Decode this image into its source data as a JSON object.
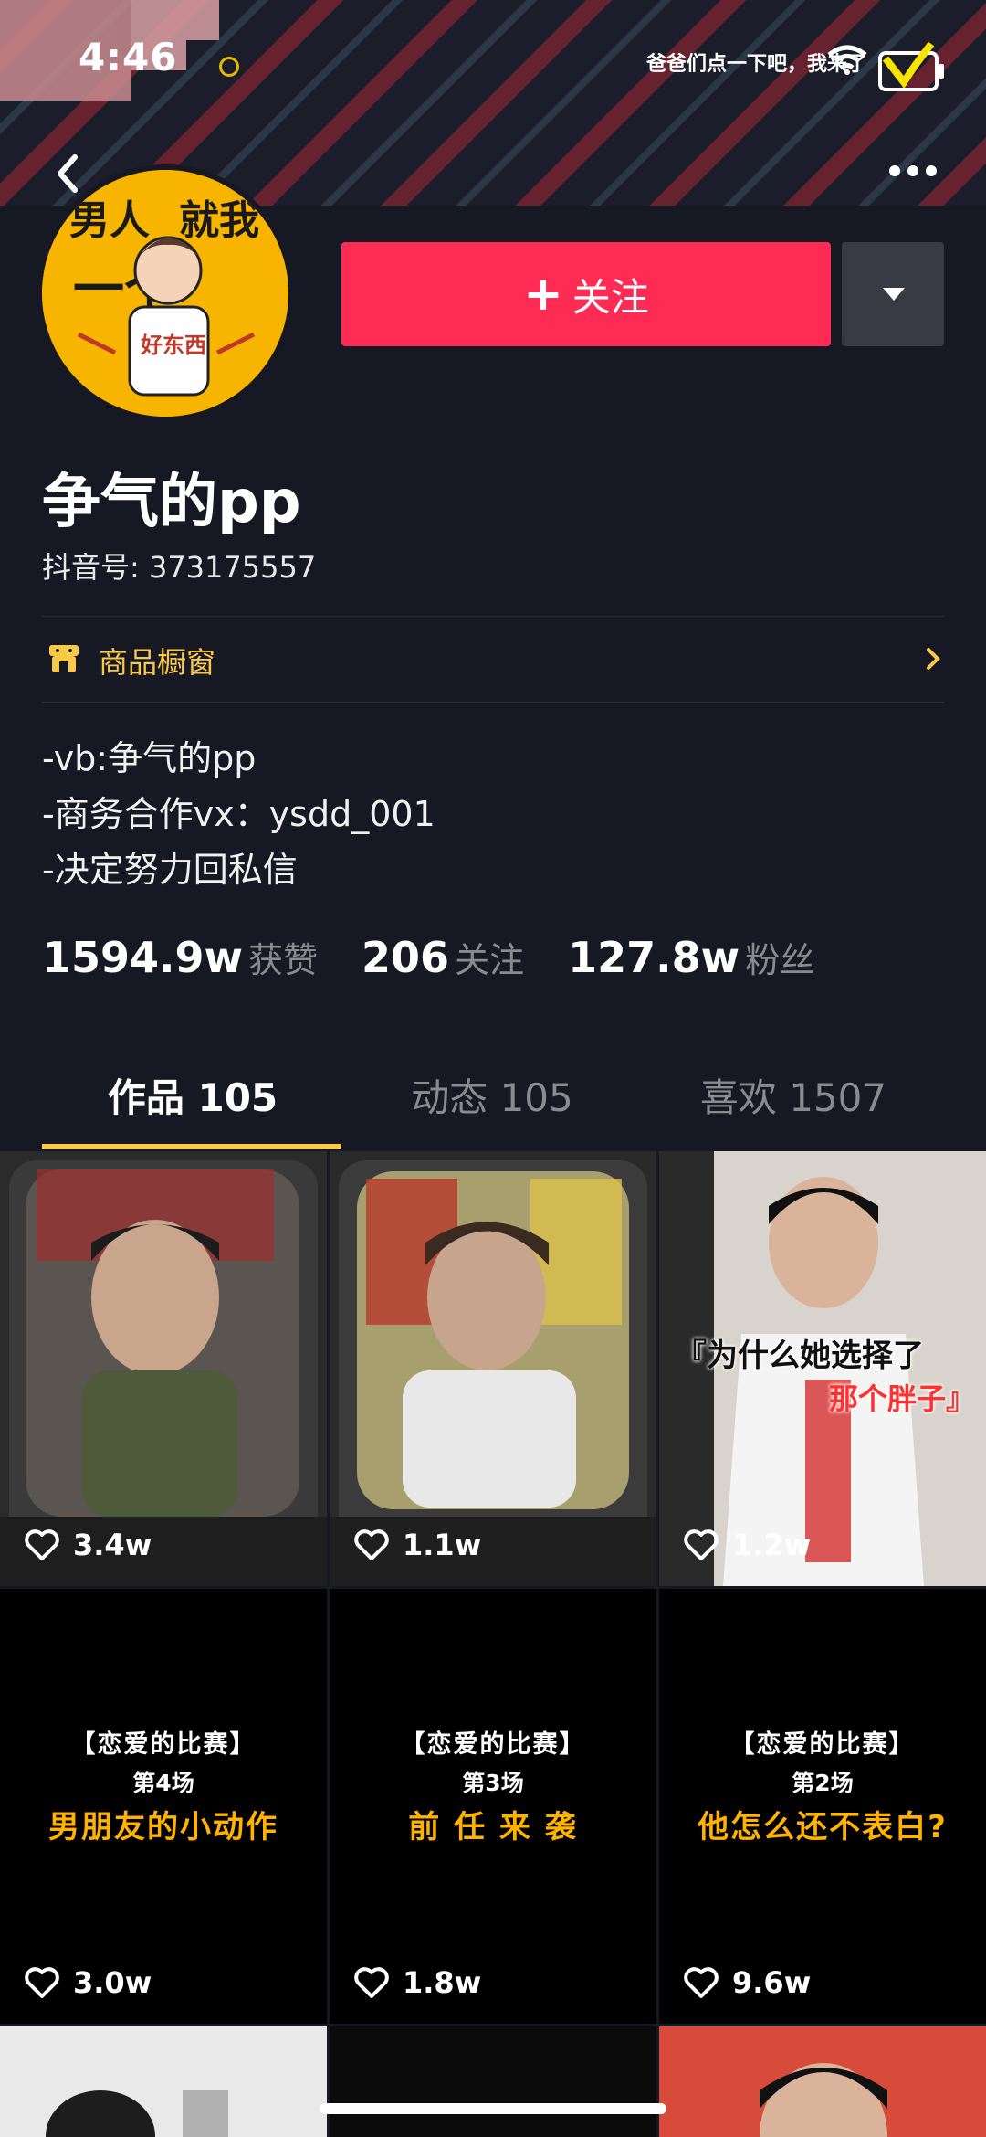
{
  "status_bar": {
    "time": "4:46",
    "ticker": "爸爸们点一下吧，我来了"
  },
  "profile": {
    "follow_label": "关注",
    "nickname": "争气的pp",
    "douyin_id": "抖音号: 373175557",
    "shop_label": "商品橱窗",
    "bio": [
      "-vb:争气的pp",
      "-商务合作vx：ysdd_001",
      "-决定努力回私信"
    ],
    "avatar_text": [
      "男人",
      "就我",
      "一个",
      "好东西"
    ]
  },
  "stats": [
    {
      "value": "1594.9w",
      "label": "获赞"
    },
    {
      "value": "206",
      "label": "关注"
    },
    {
      "value": "127.8w",
      "label": "粉丝"
    }
  ],
  "tabs": [
    {
      "label": "作品 105",
      "active": true
    },
    {
      "label": "动态 105",
      "active": false
    },
    {
      "label": "喜欢 1507",
      "active": false
    }
  ],
  "videos": [
    {
      "likes": "3.4w"
    },
    {
      "likes": "1.1w"
    },
    {
      "likes": "1.2w",
      "overlay1": "『为什么她选择了",
      "overlay2": "那个胖子』"
    },
    {
      "likes": "3.0w",
      "cap1": "【恋爱的比赛】",
      "cap2": "第4场",
      "cap3": "男朋友的小动作"
    },
    {
      "likes": "1.8w",
      "cap1": "【恋爱的比赛】",
      "cap2": "第3场",
      "cap3": "前 任 来 袭"
    },
    {
      "likes": "9.6w",
      "cap1": "【恋爱的比赛】",
      "cap2": "第2场",
      "cap3": "他怎么还不表白?"
    }
  ],
  "colors": {
    "background": "#161823",
    "follow": "#fe2c55",
    "accent": "#f9c949"
  }
}
